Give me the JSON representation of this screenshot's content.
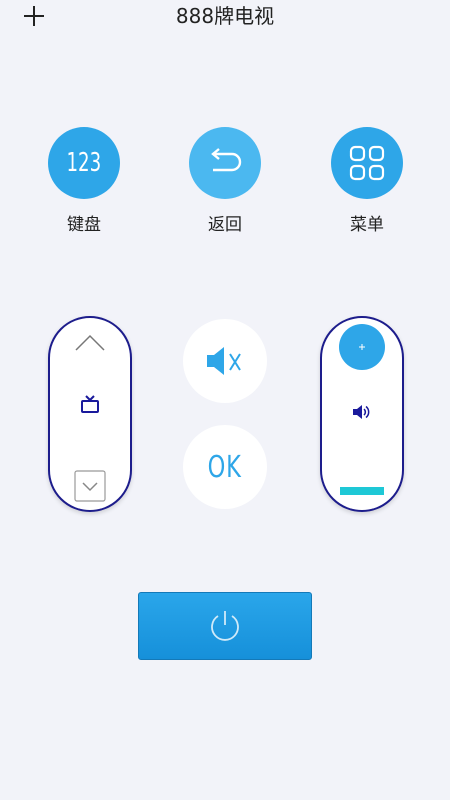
{
  "header": {
    "title": "888牌电视",
    "add_icon": "plus-icon"
  },
  "top_buttons": {
    "keyboard": {
      "icon_text": "123",
      "label": "键盘"
    },
    "back": {
      "icon": "return-arrow-icon",
      "label": "返回"
    },
    "menu": {
      "icon": "grid-menu-icon",
      "label": "菜单"
    }
  },
  "center": {
    "mute_icon": "mute-speaker-icon",
    "ok_label": "OK"
  },
  "left_pill": {
    "up_icon": "chevron-up-icon",
    "tv_icon": "tv-icon",
    "down_icon": "chevron-down-icon"
  },
  "right_pill": {
    "plus_icon": "plus-icon",
    "volume_icon": "speaker-icon",
    "minus_icon": "minus-bar-icon"
  },
  "power": {
    "icon": "power-icon"
  },
  "colors": {
    "accent": "#2ea6e8",
    "pill_border": "#1d1d8c",
    "minus_bar": "#1ec8d6",
    "tv_icon": "#1a1a9c"
  }
}
